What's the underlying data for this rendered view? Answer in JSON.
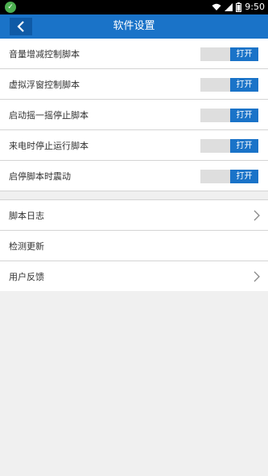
{
  "status": {
    "time": "9:50"
  },
  "header": {
    "title": "软件设置"
  },
  "toggles": [
    {
      "label": "音量增减控制脚本",
      "button": "打开"
    },
    {
      "label": "虚拟浮窗控制脚本",
      "button": "打开"
    },
    {
      "label": "启动摇一摇停止脚本",
      "button": "打开"
    },
    {
      "label": "来电时停止运行脚本",
      "button": "打开"
    },
    {
      "label": "启停脚本时震动",
      "button": "打开"
    }
  ],
  "links": [
    {
      "label": "脚本日志",
      "icon": "chevron-right-icon"
    },
    {
      "label": "检测更新"
    },
    {
      "label": "用户反馈",
      "icon": "chevron-right-icon"
    }
  ]
}
